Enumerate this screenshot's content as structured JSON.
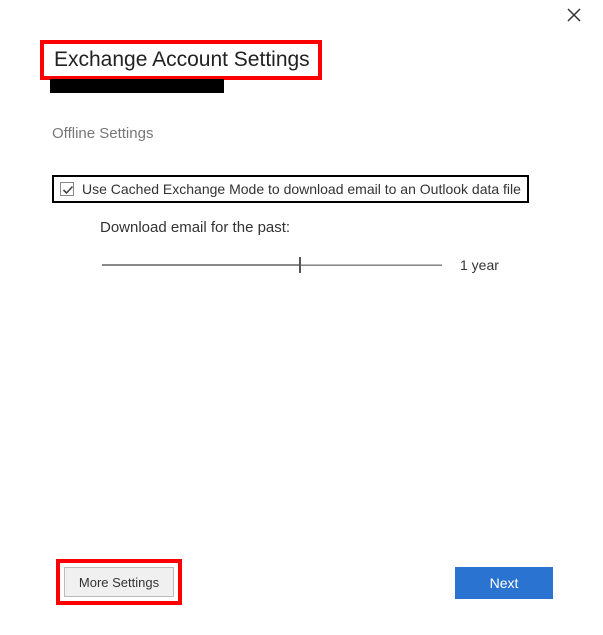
{
  "title": "Exchange Account Settings",
  "section_label": "Offline Settings",
  "cached_mode": {
    "label": "Use Cached Exchange Mode to download email to an Outlook data file",
    "checked": true
  },
  "download_past": {
    "label": "Download email for the past:",
    "value_label": "1 year"
  },
  "buttons": {
    "more_settings": "More Settings",
    "next": "Next"
  }
}
